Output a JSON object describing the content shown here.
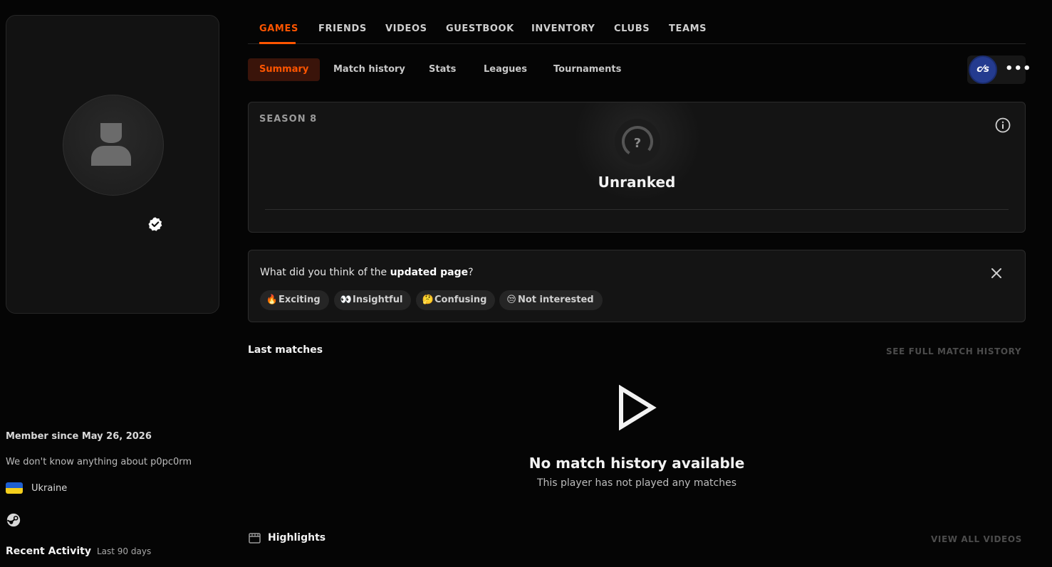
{
  "profile": {
    "member_since": "Member since May 26, 2026",
    "bio": "We don't know anything about p0pc0rm",
    "country": "Ukraine",
    "recent_activity_title": "Recent Activity",
    "recent_activity_sub": "Last 90 days"
  },
  "top_nav": {
    "items": [
      "GAMES",
      "FRIENDS",
      "VIDEOS",
      "GUESTBOOK",
      "INVENTORY",
      "CLUBS",
      "TEAMS"
    ]
  },
  "sub_nav": {
    "tabs": [
      "Summary",
      "Match history",
      "Stats",
      "Leagues",
      "Tournaments"
    ],
    "game_logo": "c⁄s",
    "more": "•••"
  },
  "season": {
    "label": "SEASON 8",
    "rank_symbol": "?",
    "rank": "Unranked"
  },
  "feedback": {
    "question_prefix": "What did you think of the ",
    "question_bold": "updated page",
    "question_suffix": "?",
    "options": [
      {
        "emoji": "🔥",
        "label": "Exciting"
      },
      {
        "emoji": "👀",
        "label": "Insightful"
      },
      {
        "emoji": "🤔",
        "label": "Confusing"
      },
      {
        "emoji": "😒",
        "label": "Not interested"
      }
    ]
  },
  "matches": {
    "title": "Last matches",
    "link": "SEE FULL MATCH HISTORY",
    "empty_title": "No match history available",
    "empty_sub": "This player has not played any matches"
  },
  "highlights": {
    "title": "Highlights",
    "link": "VIEW ALL VIDEOS"
  },
  "colors": {
    "accent": "#ff5500",
    "background": "#050505",
    "card": "#141414",
    "flag_blue": "#1e5fd0",
    "flag_yellow": "#f4cf1c"
  },
  "icons": [
    "user-placeholder-icon",
    "verified-badge-icon",
    "steam-icon",
    "info-icon",
    "close-icon",
    "play-icon",
    "film-icon",
    "more-icon"
  ]
}
